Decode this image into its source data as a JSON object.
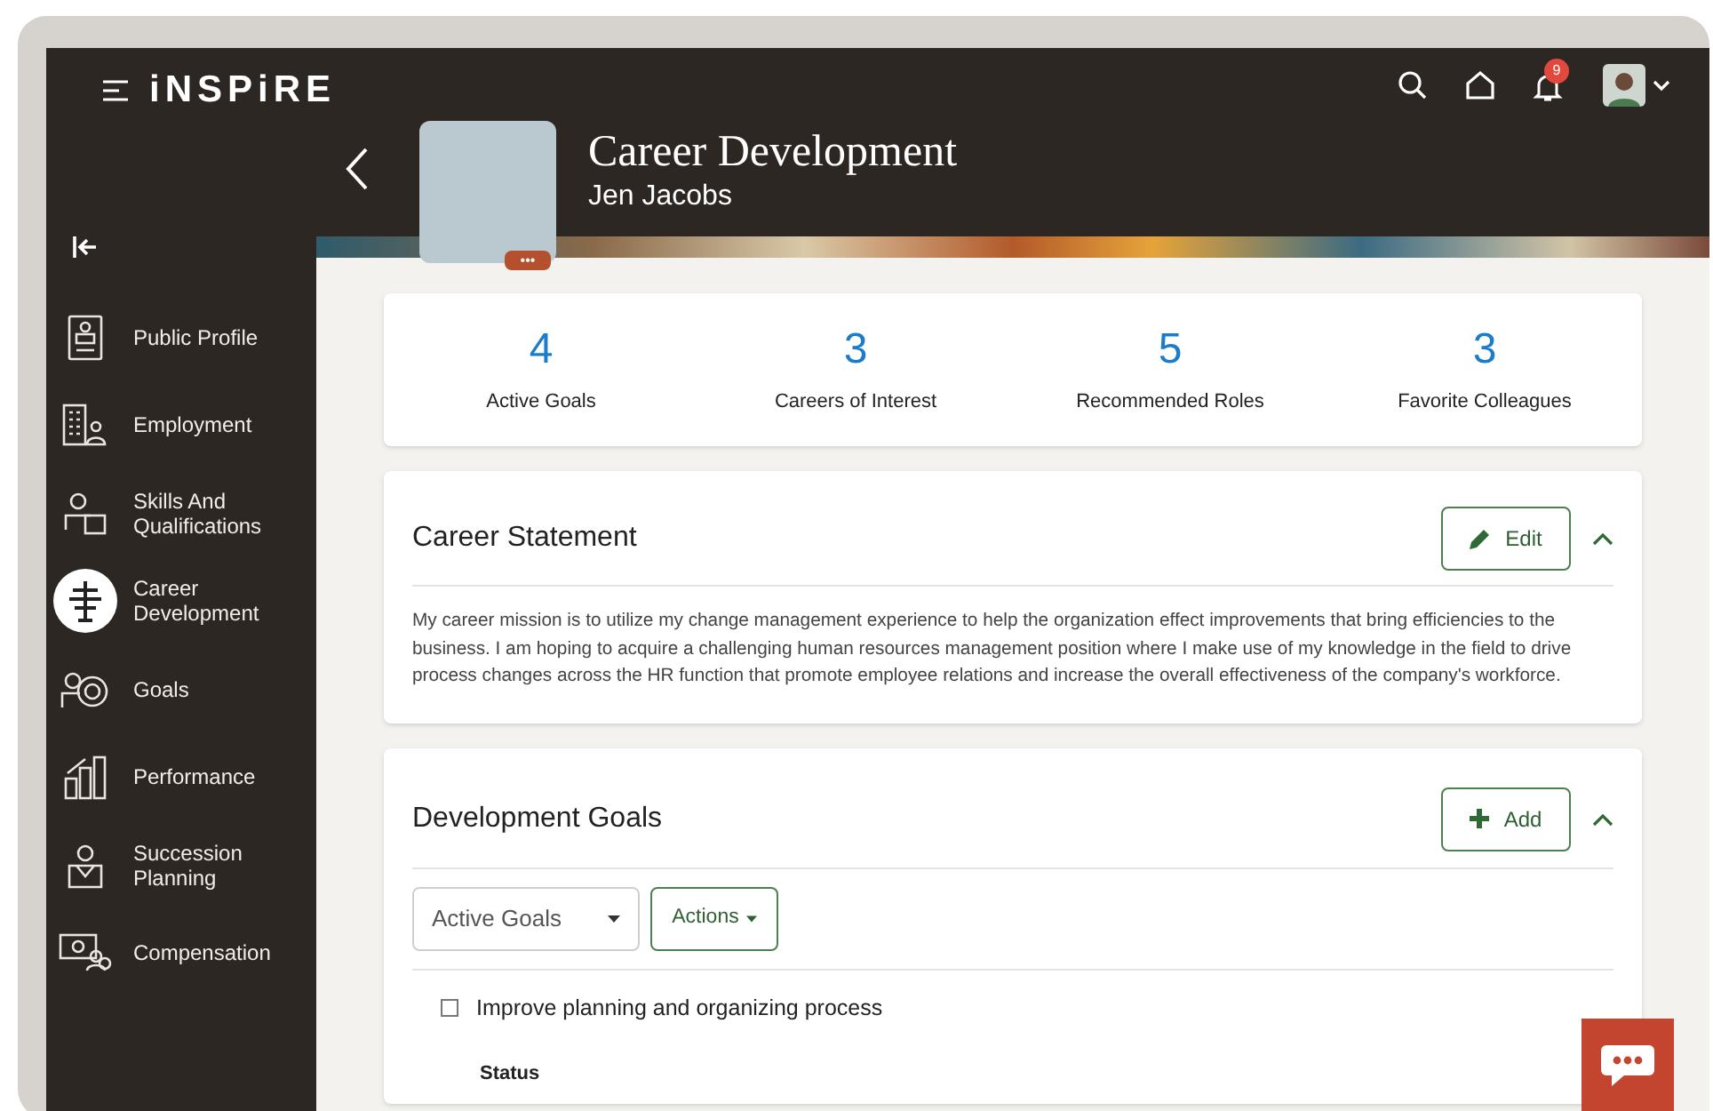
{
  "header": {
    "brand": "iNSPiRE",
    "notifications_badge": "9"
  },
  "page": {
    "title": "Career Development",
    "subtitle": "Jen Jacobs",
    "photo_menu": "•••"
  },
  "sidebar": {
    "items": [
      {
        "label": "Public Profile",
        "selected": false
      },
      {
        "label": "Employment",
        "selected": false
      },
      {
        "label": "Skills And Qualifications",
        "selected": false
      },
      {
        "label": "Career Development",
        "selected": true
      },
      {
        "label": "Goals",
        "selected": false
      },
      {
        "label": "Performance",
        "selected": false
      },
      {
        "label": "Succession Planning",
        "selected": false
      },
      {
        "label": "Compensation",
        "selected": false
      }
    ]
  },
  "stats": [
    {
      "value": "4",
      "label": "Active Goals"
    },
    {
      "value": "3",
      "label": "Careers of Interest"
    },
    {
      "value": "5",
      "label": "Recommended Roles"
    },
    {
      "value": "3",
      "label": "Favorite Colleagues"
    }
  ],
  "career_statement": {
    "title": "Career Statement",
    "button": "Edit",
    "expanded": true,
    "text": "My career mission is to utilize my change management experience to help the organization effect improvements that bring efficiencies to the business. I am hoping to acquire a challenging human resources management position where I make use of my knowledge in the field to drive process changes across the HR function that promote employee relations and increase the overall effectiveness of the company's workforce."
  },
  "development_goals": {
    "title": "Development Goals",
    "button": "Add",
    "expanded": true,
    "filter": "Active Goals",
    "actions": "Actions",
    "goals": [
      {
        "title": "Improve planning and organizing process",
        "checked": false,
        "field_label": "Status"
      }
    ]
  }
}
